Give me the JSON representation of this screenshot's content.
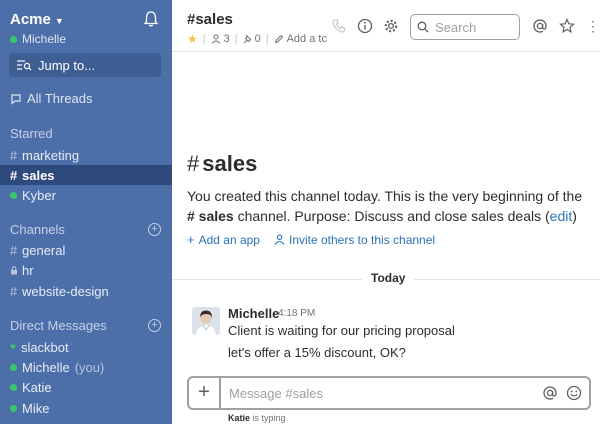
{
  "sidebar": {
    "team_name": "Acme",
    "user_name": "Michelle",
    "jump_label": "Jump to...",
    "all_threads": "All Threads",
    "starred_title": "Starred",
    "starred": [
      {
        "prefix": "#",
        "label": "marketing"
      },
      {
        "prefix": "#",
        "label": "sales"
      },
      {
        "prefix": "",
        "label": "Kyber"
      }
    ],
    "channels_title": "Channels",
    "channels": [
      {
        "prefix": "#",
        "label": "general"
      },
      {
        "prefix": "",
        "label": "hr"
      },
      {
        "prefix": "#",
        "label": "website-design"
      }
    ],
    "dm_title": "Direct Messages",
    "dms": [
      {
        "label": "slackbot"
      },
      {
        "label": "Michelle",
        "suffix": "(you)"
      },
      {
        "label": "Katie"
      },
      {
        "label": "Mike"
      }
    ]
  },
  "header": {
    "title": "#sales",
    "members": "3",
    "pins": "0",
    "add_topic": "Add a tc",
    "search_placeholder": "Search"
  },
  "intro": {
    "hash": "#",
    "title": "sales",
    "text_1": "You created this channel today. This is the very beginning of the",
    "text_hash": "# sales",
    "text_2": " channel. Purpose: Discuss and close sales deals (",
    "edit_link": "edit",
    "text_3": ")",
    "add_app": "Add an app",
    "invite": "Invite others to this channel"
  },
  "divider_label": "Today",
  "message": {
    "author": "Michelle",
    "time": "4:18 PM",
    "lines": [
      "Client is waiting for our pricing proposal",
      "let's offer a 15% discount, OK?"
    ]
  },
  "composer": {
    "placeholder": "Message #sales",
    "typing_user": "Katie",
    "typing_text": " is typing"
  },
  "colors": {
    "sidebar_bg": "#4d6fa9",
    "sidebar_active": "#2e4a7c",
    "presence": "#39c86a",
    "link": "#2b73b8",
    "star": "#f2c744"
  }
}
